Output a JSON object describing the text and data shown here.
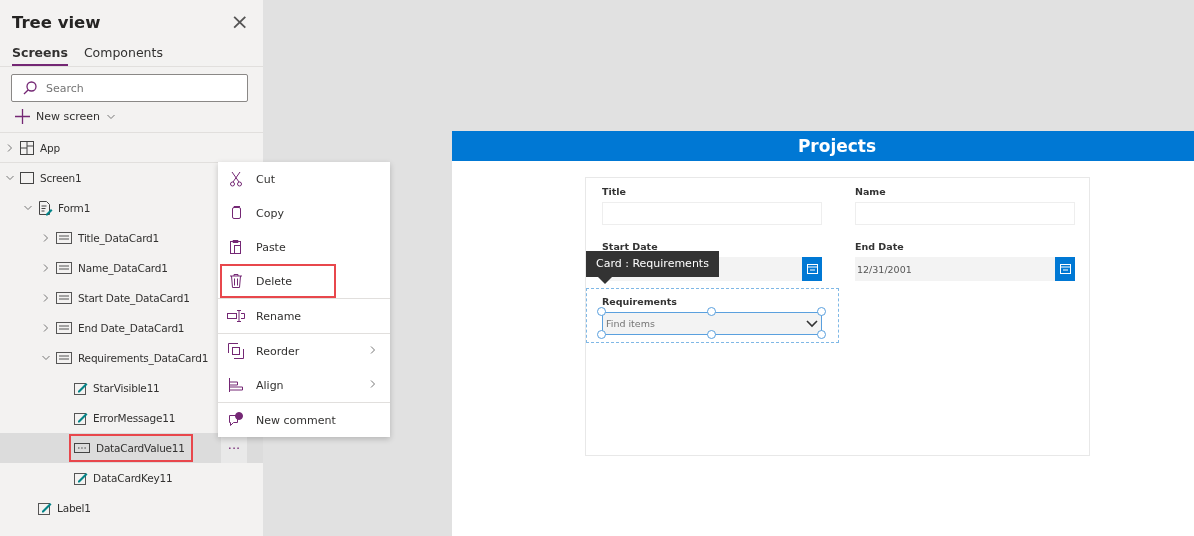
{
  "panel": {
    "title": "Tree view",
    "close": "×",
    "tabs": [
      {
        "label": "Screens",
        "selected": true
      },
      {
        "label": "Components",
        "selected": false
      }
    ],
    "search": {
      "placeholder": "Search"
    },
    "new_screen": "New screen"
  },
  "tree": {
    "items": [
      {
        "label": "App",
        "kind": "app",
        "expanded": false,
        "selected": false,
        "highlighted": false
      },
      {
        "label": "Screen1",
        "kind": "screen",
        "expanded": true,
        "selected": false,
        "highlighted": false,
        "children": [
          {
            "label": "Form1",
            "kind": "form",
            "expanded": true,
            "selected": false,
            "highlighted": false,
            "children": [
              {
                "label": "Title_DataCard1",
                "kind": "card",
                "expanded": false,
                "selected": false,
                "highlighted": false
              },
              {
                "label": "Name_DataCard1",
                "kind": "card",
                "expanded": false,
                "selected": false,
                "highlighted": false
              },
              {
                "label": "Start Date_DataCard1",
                "kind": "card",
                "expanded": false,
                "selected": false,
                "highlighted": false
              },
              {
                "label": "End Date_DataCard1",
                "kind": "card",
                "expanded": false,
                "selected": false,
                "highlighted": false
              },
              {
                "label": "Requirements_DataCard1",
                "kind": "card",
                "expanded": true,
                "selected": false,
                "highlighted": false,
                "children": [
                  {
                    "label": "StarVisible11",
                    "kind": "label",
                    "selected": false,
                    "highlighted": false
                  },
                  {
                    "label": "ErrorMessage11",
                    "kind": "label",
                    "selected": false,
                    "highlighted": false
                  },
                  {
                    "label": "DataCardValue11",
                    "kind": "combo",
                    "selected": true,
                    "highlighted": true,
                    "more": "···"
                  },
                  {
                    "label": "DataCardKey11",
                    "kind": "label",
                    "selected": false,
                    "highlighted": false
                  }
                ]
              }
            ]
          },
          {
            "label": "Label1",
            "kind": "label",
            "selected": false,
            "highlighted": false
          }
        ]
      }
    ]
  },
  "context_menu": {
    "groups": [
      [
        {
          "label": "Cut",
          "kind": "cut",
          "submenu": false,
          "highlighted": false
        },
        {
          "label": "Copy",
          "kind": "copy",
          "submenu": false,
          "highlighted": false
        },
        {
          "label": "Paste",
          "kind": "paste",
          "submenu": false,
          "highlighted": false
        },
        {
          "label": "Delete",
          "kind": "delete",
          "submenu": false,
          "highlighted": true
        }
      ],
      [
        {
          "label": "Rename",
          "kind": "rename",
          "submenu": false,
          "highlighted": false
        }
      ],
      [
        {
          "label": "Reorder",
          "kind": "reorder",
          "submenu": true,
          "highlighted": false
        },
        {
          "label": "Align",
          "kind": "align",
          "submenu": true,
          "highlighted": false
        }
      ],
      [
        {
          "label": "New comment",
          "kind": "comment",
          "submenu": false,
          "highlighted": false
        }
      ]
    ]
  },
  "app_screen": {
    "header": "Projects",
    "form": {
      "fields": [
        {
          "label": "Title",
          "kind": "text",
          "selected": false
        },
        {
          "label": "Name",
          "kind": "text",
          "selected": false
        },
        {
          "label": "Start Date",
          "kind": "date",
          "selected": false
        },
        {
          "label": "End Date",
          "kind": "date",
          "value": "12/31/2001",
          "selected": false
        },
        {
          "label": "Requirements",
          "kind": "combo",
          "placeholder": "Find items",
          "selected": true
        }
      ]
    },
    "tooltip": "Card : Requirements"
  }
}
